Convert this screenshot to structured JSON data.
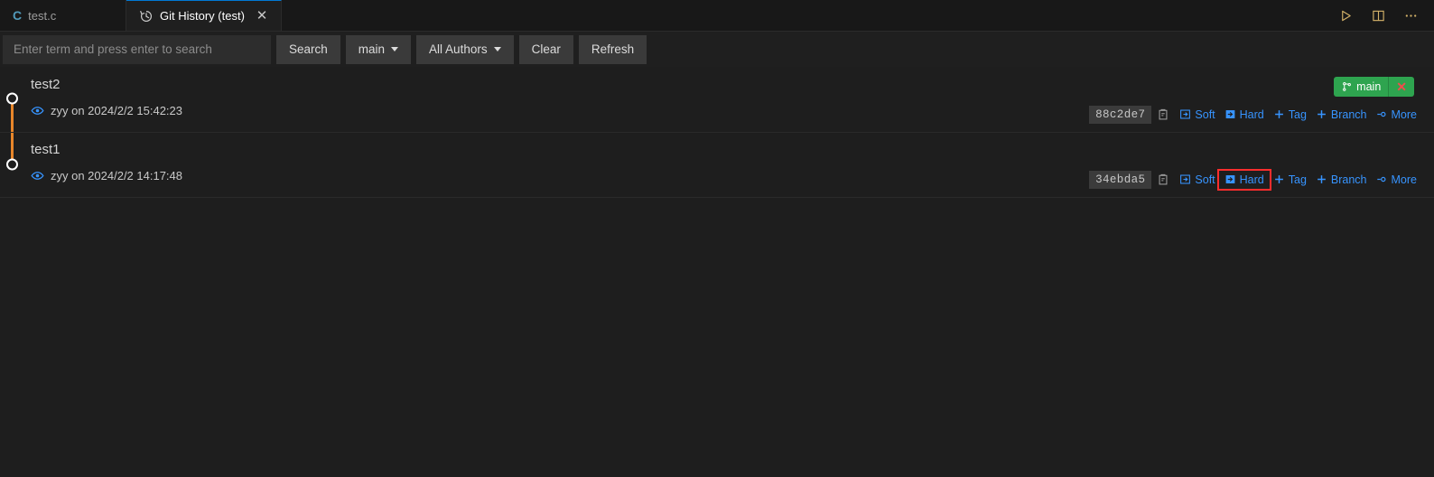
{
  "window": {
    "tabs": [
      {
        "label": "test.c",
        "icon": "c-file-icon",
        "active": false
      },
      {
        "label": "Git History (test)",
        "icon": "history-icon",
        "active": true
      }
    ],
    "actions": [
      {
        "name": "run-icon",
        "label": "Run"
      },
      {
        "name": "split-editor-icon",
        "label": "Split Editor"
      },
      {
        "name": "more-actions-icon",
        "label": "More Actions..."
      }
    ]
  },
  "toolbar": {
    "search_placeholder": "Enter term and press enter to search",
    "search_value": "",
    "search_button": "Search",
    "branch_select": "main",
    "author_select": "All Authors",
    "clear_button": "Clear",
    "refresh_button": "Refresh"
  },
  "commits": [
    {
      "subject": "test2",
      "author": "zyy",
      "meta": "zyy on 2024/2/2 15:42:23",
      "hash": "88c2de7",
      "branch_badge": {
        "label": "main",
        "color": "#2ea44f",
        "close": "✕"
      },
      "actions": [
        {
          "name": "soft-reset-button",
          "label": "Soft",
          "icon": "reset-soft-icon",
          "highlighted": false
        },
        {
          "name": "hard-reset-button",
          "label": "Hard",
          "icon": "reset-hard-icon",
          "highlighted": false
        },
        {
          "name": "add-tag-button",
          "label": "Tag",
          "icon": "plus-icon",
          "highlighted": false
        },
        {
          "name": "add-branch-button",
          "label": "Branch",
          "icon": "plus-icon",
          "highlighted": false
        },
        {
          "name": "more-button",
          "label": "More",
          "icon": "commit-icon",
          "highlighted": false
        }
      ]
    },
    {
      "subject": "test1",
      "author": "zyy",
      "meta": "zyy on 2024/2/2 14:17:48",
      "hash": "34ebda5",
      "branch_badge": null,
      "actions": [
        {
          "name": "soft-reset-button",
          "label": "Soft",
          "icon": "reset-soft-icon",
          "highlighted": false
        },
        {
          "name": "hard-reset-button",
          "label": "Hard",
          "icon": "reset-hard-icon",
          "highlighted": true
        },
        {
          "name": "add-tag-button",
          "label": "Tag",
          "icon": "plus-icon",
          "highlighted": false
        },
        {
          "name": "add-branch-button",
          "label": "Branch",
          "icon": "plus-icon",
          "highlighted": false
        },
        {
          "name": "more-button",
          "label": "More",
          "icon": "commit-icon",
          "highlighted": false
        }
      ]
    }
  ],
  "graph": {
    "node_color": "#ffffff",
    "line_color": "#e8862a"
  },
  "colors": {
    "accent": "#3794ff",
    "highlight": "#ff2d2d",
    "branch_green": "#2ea44f",
    "background": "#1e1e1e"
  }
}
